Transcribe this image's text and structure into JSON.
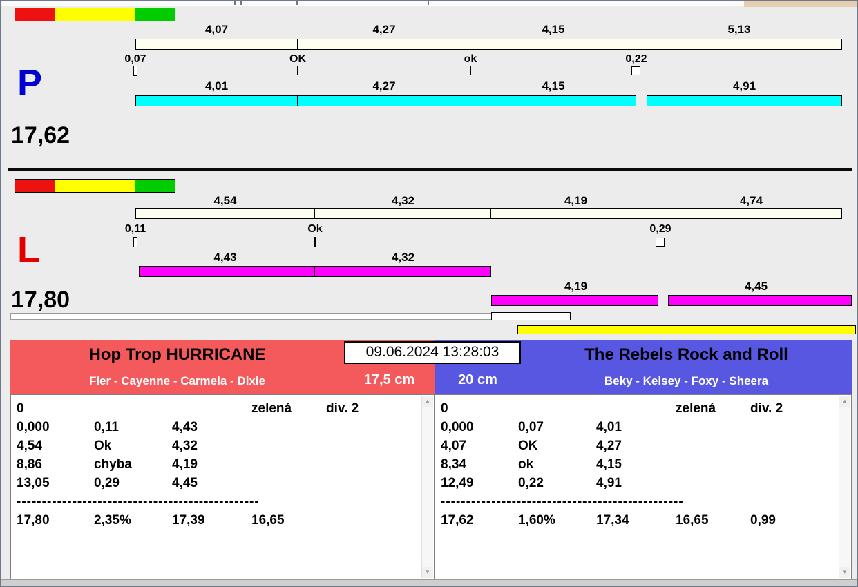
{
  "window": {
    "timestamp": "09.06.2024 13:28:03"
  },
  "icons": {
    "scroll_up": "▲",
    "scroll_down": "▼"
  },
  "lane_p": {
    "label": "P",
    "label_color": "#0000d0",
    "total": "17,62",
    "signals": [
      "#ee1111",
      "#ffff00",
      "#ffff00",
      "#00cc00"
    ],
    "upper_bar_color": "#fffff0",
    "upper_values": [
      "4,07",
      "4,27",
      "4,15",
      "5,13"
    ],
    "marks": [
      "0,07",
      "OK",
      "ok",
      "0,22"
    ],
    "lower_bar_color": "#00ffff",
    "lower_values": [
      "4,01",
      "4,27",
      "4,15",
      "4,91"
    ]
  },
  "lane_l": {
    "label": "L",
    "label_color": "#e00000",
    "total": "17,80",
    "signals": [
      "#ee1111",
      "#ffff00",
      "#ffff00",
      "#00cc00"
    ],
    "upper_bar_color": "#fffff0",
    "upper_values": [
      "4,54",
      "4,32",
      "4,19",
      "4,74"
    ],
    "marks": [
      "0,11",
      "Ok",
      "0,29"
    ],
    "lower_bar_color": "#ff00ff",
    "row1_values": [
      "4,43",
      "4,32"
    ],
    "row2_values": [
      "4,19",
      "4,45"
    ],
    "extra_bar_color": "#ffff00"
  },
  "team_left": {
    "name": "Hop Trop HURRICANE",
    "dogs": "Fler - Cayenne - Carmela - Dixie",
    "height": "17,5 cm",
    "header_color": "#f4595c",
    "rows": [
      [
        "0",
        "",
        "",
        "zelená",
        "div. 2"
      ],
      [
        "0,000",
        "0,11",
        "4,43",
        "",
        ""
      ],
      [
        "4,54",
        "Ok",
        "4,32",
        "",
        ""
      ],
      [
        "8,86",
        "chyba",
        "4,19",
        "",
        ""
      ],
      [
        "13,05",
        "0,29",
        "4,45",
        "",
        ""
      ],
      "------------------------------------------------",
      [
        "17,80",
        "2,35%",
        "17,39",
        "16,65",
        ""
      ]
    ]
  },
  "team_right": {
    "name": "The Rebels Rock and Roll",
    "dogs": "Beky - Kelsey - Foxy - Sheera",
    "height": "20 cm",
    "header_color": "#5757e2",
    "rows": [
      [
        "0",
        "",
        "",
        "zelená",
        "div. 2"
      ],
      [
        "0,000",
        "0,07",
        "4,01",
        "",
        ""
      ],
      [
        "4,07",
        "OK",
        "4,27",
        "",
        ""
      ],
      [
        "8,34",
        "ok",
        "4,15",
        "",
        ""
      ],
      [
        "12,49",
        "0,22",
        "4,91",
        "",
        ""
      ],
      "------------------------------------------------",
      [
        "17,62",
        "1,60%",
        "17,34",
        "16,65",
        "0,99"
      ]
    ]
  }
}
